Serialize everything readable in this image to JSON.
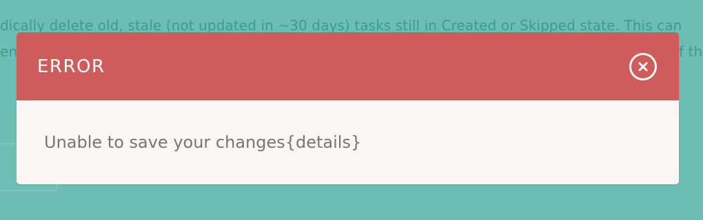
{
  "background": {
    "line1": "dically delete old, stale (not updated in ~30 days) tasks still in Created or Skipped state. This can",
    "line2": "eng",
    "line3": "f the"
  },
  "modal": {
    "title": "ERROR",
    "message": "Unable to save your changes{details}",
    "close_icon": "close-circle-icon"
  },
  "colors": {
    "page_bg": "#6cbeb2",
    "header_bg": "#d05b5b",
    "body_bg": "#faf6f4",
    "message_text": "#767676",
    "title_text": "#ffffff"
  }
}
